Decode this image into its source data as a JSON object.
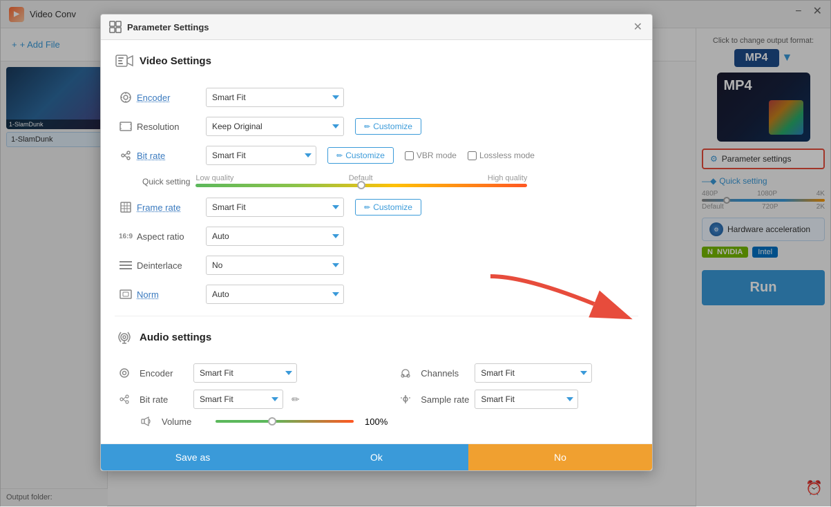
{
  "app": {
    "title": "Video Conv",
    "title_full": "Video Converter",
    "add_file_label": "+ Add File",
    "output_folder_label": "Output folder:",
    "run_label": "Run"
  },
  "dialog": {
    "title": "Parameter Settings",
    "close_label": "✕",
    "video_section_title": "Video Settings",
    "audio_section_title": "Audio settings",
    "save_as_label": "Save as",
    "ok_label": "Ok",
    "no_label": "No"
  },
  "video_settings": {
    "encoder_label": "Encoder",
    "encoder_value": "Smart Fit",
    "resolution_label": "Resolution",
    "resolution_value": "Keep Original",
    "customize_label": "Customize",
    "bitrate_label": "Bit rate",
    "bitrate_value": "Smart Fit",
    "customize2_label": "Customize",
    "vbr_mode_label": "VBR mode",
    "lossless_mode_label": "Lossless mode",
    "quick_setting_label": "Quick setting",
    "low_quality_label": "Low quality",
    "default_label": "Default",
    "high_quality_label": "High quality",
    "frame_rate_label": "Frame rate",
    "frame_rate_value": "Smart Fit",
    "customize3_label": "Customize",
    "aspect_ratio_label": "Aspect ratio",
    "aspect_ratio_value": "Auto",
    "deinterlace_label": "Deinterlace",
    "deinterlace_value": "No",
    "norm_label": "Norm",
    "norm_value": "Auto"
  },
  "audio_settings": {
    "encoder_label": "Encoder",
    "encoder_value": "Smart Fit",
    "channels_label": "Channels",
    "channels_value": "Smart Fit",
    "bitrate_label": "Bit rate",
    "bitrate_value": "Smart Fit",
    "sample_rate_label": "Sample rate",
    "sample_rate_value": "Smart Fit",
    "volume_label": "Volume",
    "volume_percent": "100%"
  },
  "sidebar": {
    "format_label": "Click to change output format:",
    "format_name": "MP4",
    "param_settings_label": "Parameter settings",
    "quick_setting_label": "Quick setting",
    "quality_labels": [
      "480P",
      "1080P",
      "4K"
    ],
    "quality_sublabels": [
      "Default",
      "720P",
      "2K"
    ],
    "hardware_acceleration_label": "Hardware acceleration",
    "nvidia_label": "NVIDIA",
    "intel_label": "Intel"
  },
  "file": {
    "name": "1-SlamDunk"
  }
}
